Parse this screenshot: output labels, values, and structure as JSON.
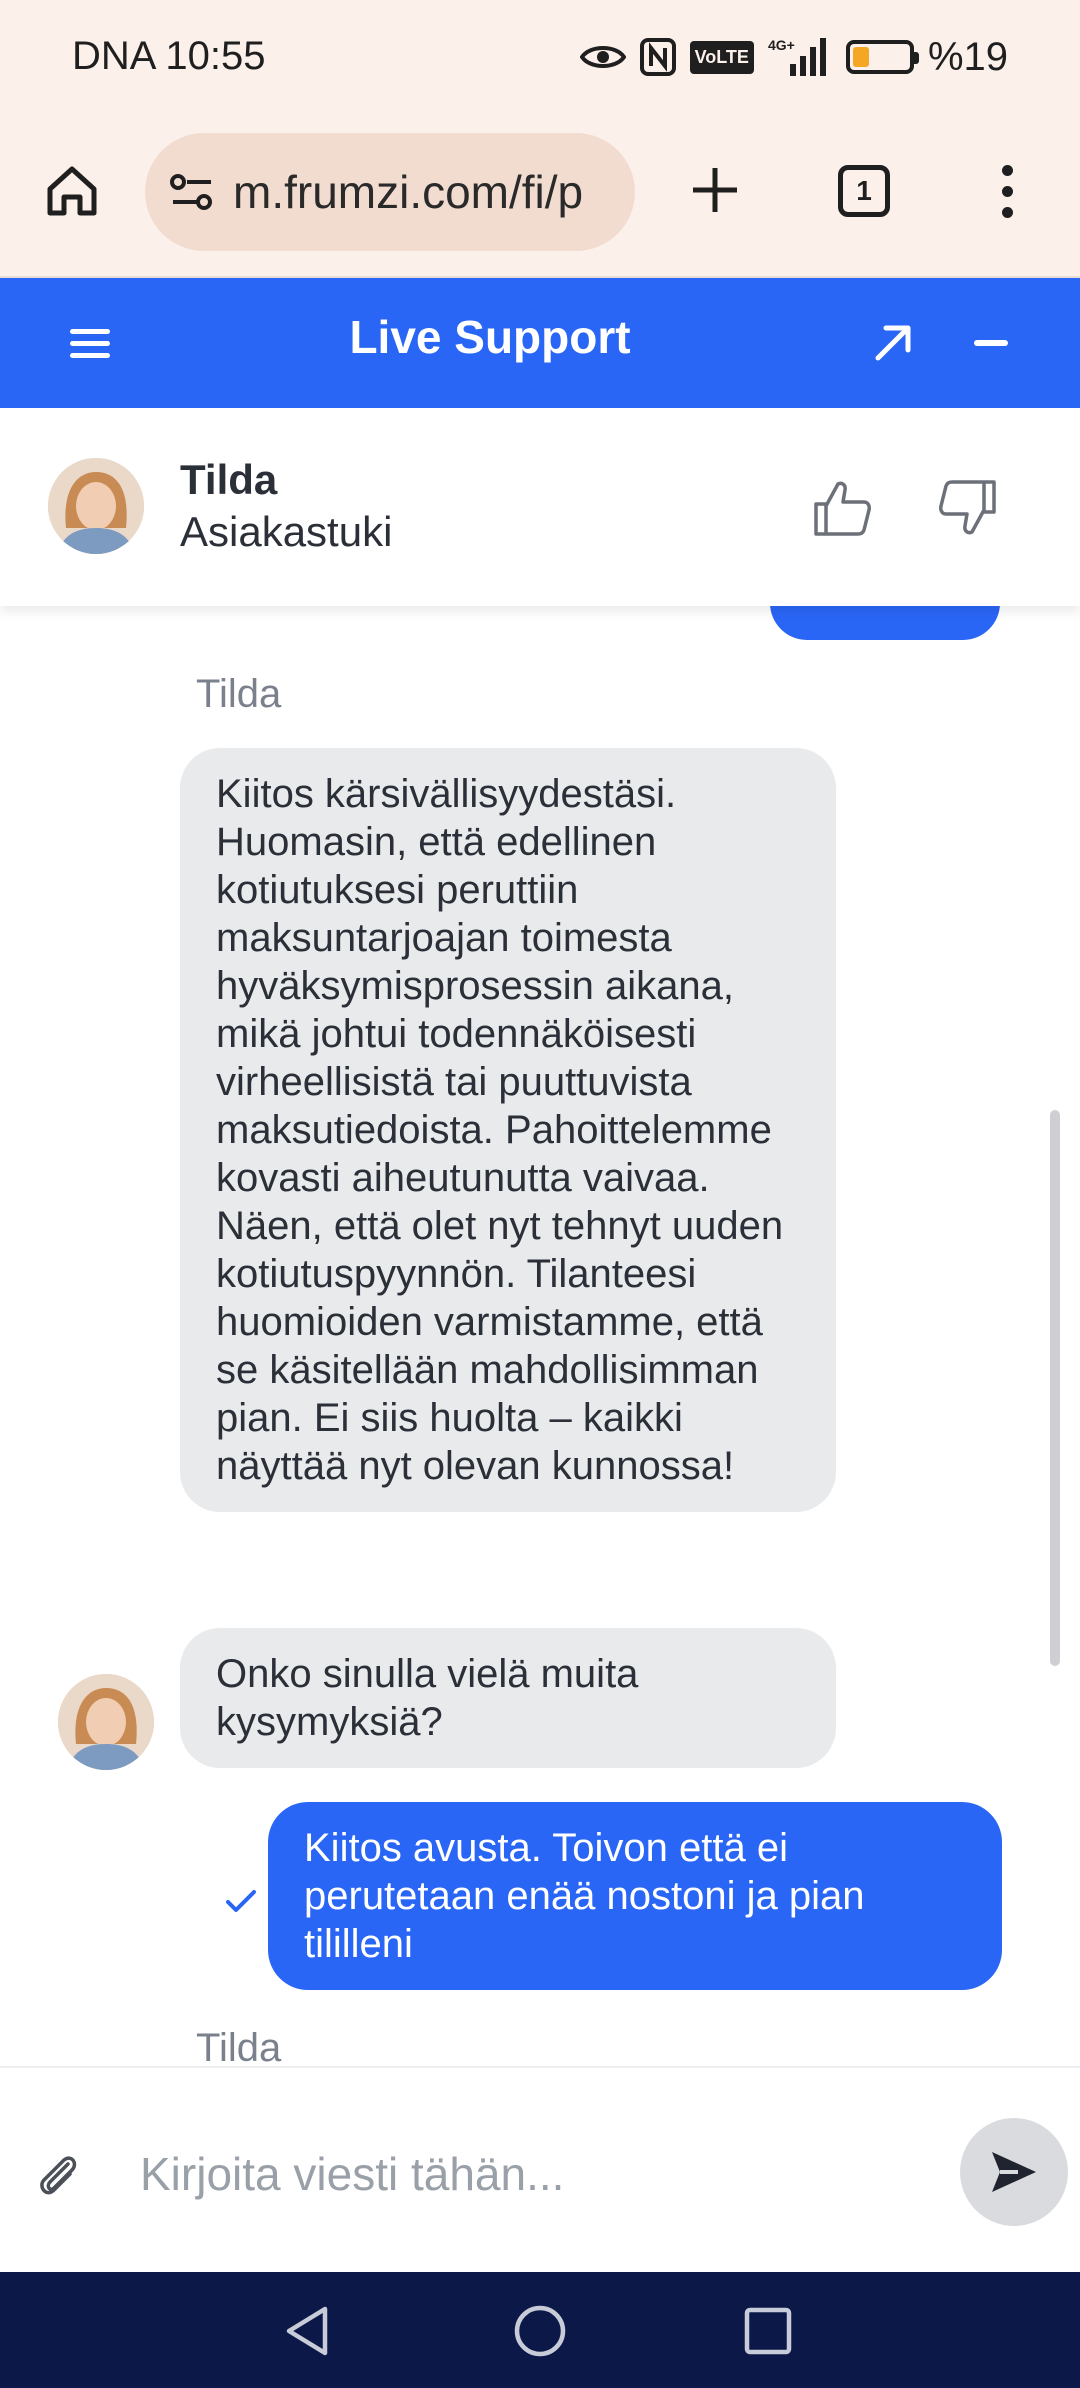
{
  "status_bar": {
    "carrier_time": "DNA 10:55",
    "network_label": "VoLTE",
    "signal_label": "4G+",
    "battery_percent": "%19",
    "battery_level": 0.19
  },
  "browser": {
    "url": "m.frumzi.com/fi/p",
    "tab_count": "1"
  },
  "header": {
    "title": "Live Support"
  },
  "agent": {
    "name": "Tilda",
    "role": "Asiakastuki"
  },
  "messages": [
    {
      "sender": "Tilda",
      "direction": "incoming",
      "text": "Kiitos kärsivällisyydestäsi. Huomasin, että edellinen kotiutuksesi peruttiin maksuntarjoajan toimesta hyväksymisprosessin aikana, mikä johtui todennäköisesti virheellisistä tai puuttuvista maksutiedoista. Pahoittelemme kovasti aiheutunutta vaivaa.\nNäen, että olet nyt tehnyt uuden kotiutuspyynnön. Tilanteesi huomioiden varmistamme, että se käsitellään mahdollisimman pian. Ei siis huolta – kaikki näyttää nyt olevan kunnossa!"
    },
    {
      "direction": "incoming",
      "text": "Onko sinulla vielä muita kysymyksiä?"
    },
    {
      "direction": "outgoing",
      "text": "Kiitos avusta. Toivon että ei perutetaan enää nostoni ja pian tililleni"
    },
    {
      "sender": "Tilda",
      "direction": "incoming"
    }
  ],
  "input": {
    "placeholder": "Kirjoita viesti tähän...",
    "value": ""
  },
  "colors": {
    "accent": "#2a66f6",
    "incoming_bubble": "#e9eaec",
    "nav_bar": "#0c1847",
    "status_bar": "#fcf0eb"
  }
}
